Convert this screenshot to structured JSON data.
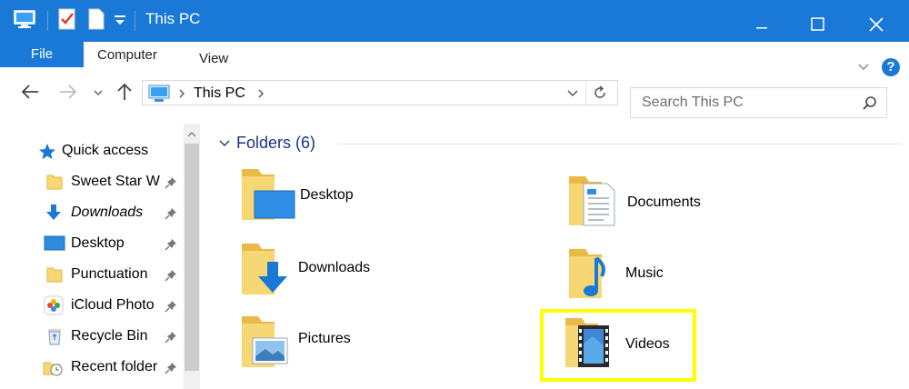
{
  "window": {
    "title": "This PC",
    "title_bar_color": "#1a79d6"
  },
  "ribbon": {
    "tabs": [
      "File",
      "Computer",
      "View"
    ],
    "help_glyph": "?"
  },
  "navigation": {
    "breadcrumb": [
      "This PC"
    ],
    "search_placeholder": "Search This PC"
  },
  "sidebar": {
    "quick_access_label": "Quick access",
    "items": [
      {
        "label": "Sweet Star W",
        "icon": "folder-icon",
        "pinned": true
      },
      {
        "label": "Downloads",
        "icon": "downloads-icon",
        "pinned": true
      },
      {
        "label": "Desktop",
        "icon": "desktop-icon",
        "pinned": true
      },
      {
        "label": "Punctuation",
        "icon": "folder-icon",
        "pinned": true
      },
      {
        "label": "iCloud Photo",
        "icon": "icloud-photos-icon",
        "pinned": true
      },
      {
        "label": "Recycle Bin",
        "icon": "recycle-bin-icon",
        "pinned": true
      },
      {
        "label": "Recent folder",
        "icon": "recent-folders-icon",
        "pinned": true
      }
    ]
  },
  "content": {
    "group_title": "Folders (6)",
    "folders": [
      {
        "label": "Desktop",
        "icon": "desktop-folder-icon"
      },
      {
        "label": "Documents",
        "icon": "documents-folder-icon"
      },
      {
        "label": "Downloads",
        "icon": "downloads-folder-icon"
      },
      {
        "label": "Music",
        "icon": "music-folder-icon"
      },
      {
        "label": "Pictures",
        "icon": "pictures-folder-icon"
      },
      {
        "label": "Videos",
        "icon": "videos-folder-icon"
      }
    ],
    "highlight_color": "#ffff00"
  }
}
